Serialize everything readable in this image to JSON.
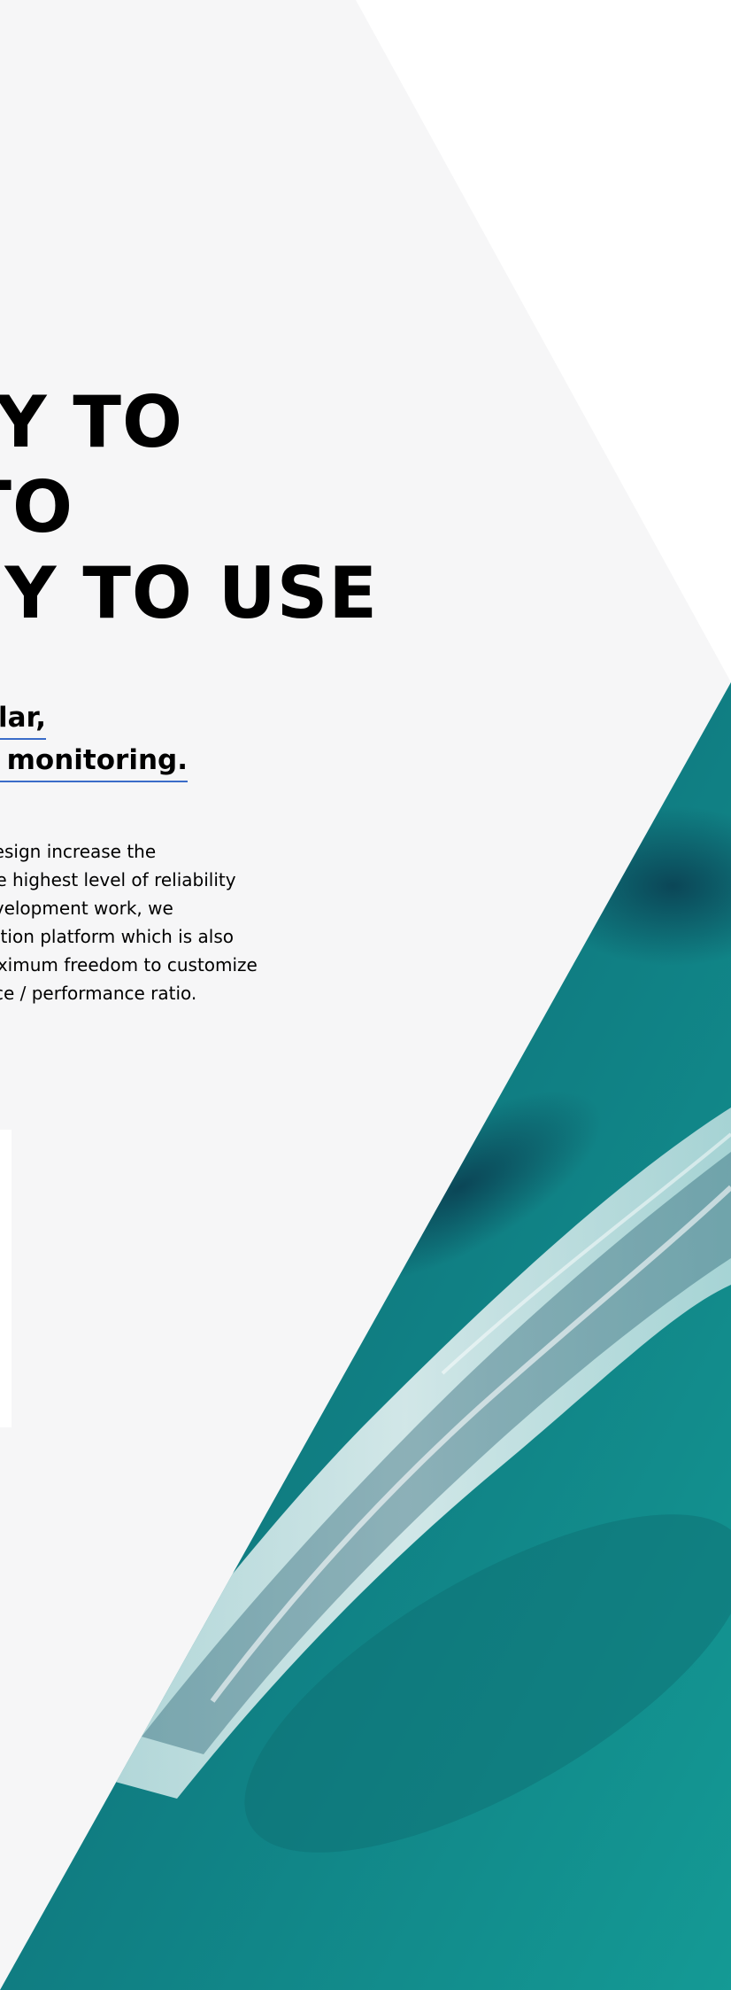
{
  "hero": {
    "headline_lines": [
      "SY TO",
      "TO",
      "SY TO USE"
    ],
    "subheading_lines": [
      "lar,",
      "e monitoring."
    ],
    "body_lines": [
      "and design increase the",
      "tee the highest level of reliability",
      "nd development work, we",
      "mentation platform which is also",
      "es maximum freedom to customize",
      "ve price / performance ratio."
    ]
  },
  "colors": {
    "background": "#ffffff",
    "panel": "#f6f6f7",
    "link_underline": "#3a6cc8",
    "ocean_deep": "#0a5f68",
    "ocean_teal": "#1a8f8f",
    "foam": "#e8f3f4"
  }
}
